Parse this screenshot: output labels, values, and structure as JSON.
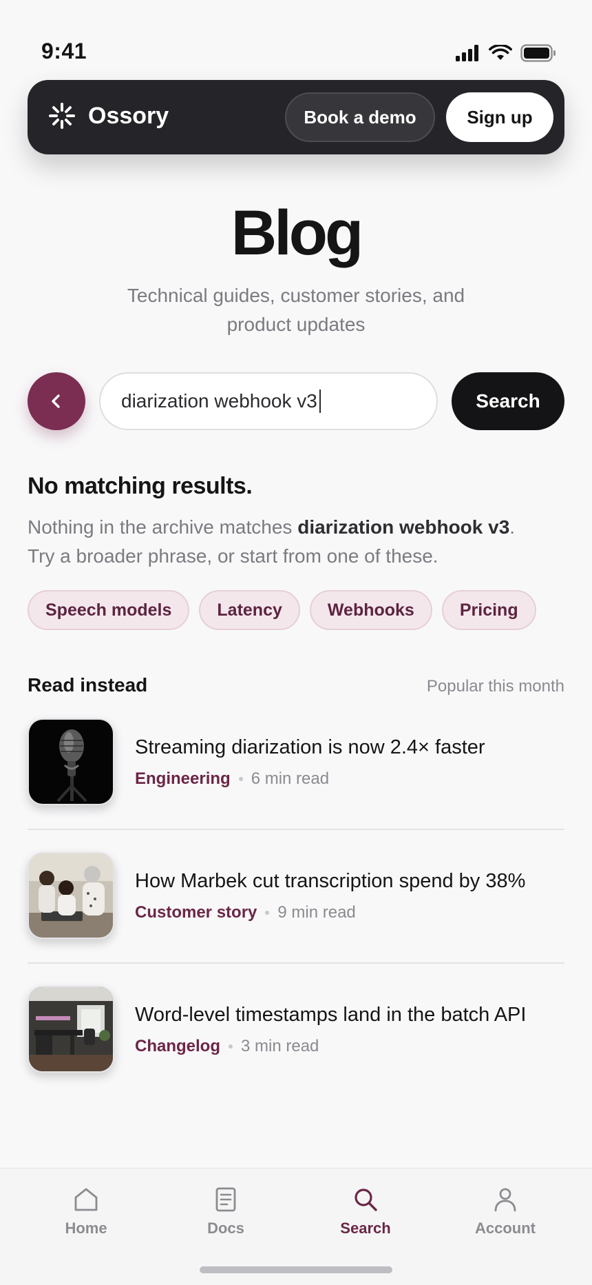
{
  "status_bar": {
    "time": "9:41"
  },
  "nav": {
    "brand": "Ossory",
    "book_demo": "Book a demo",
    "sign_up": "Sign up"
  },
  "header": {
    "title": "Blog",
    "subtitle": "Technical guides, customer stories, and product updates"
  },
  "search": {
    "query": "diarization webhook v3",
    "button": "Search"
  },
  "empty_state": {
    "title": "No matching results.",
    "text_prefix": "Nothing in the archive matches ",
    "query": "diarization webhook v3",
    "text_suffix": ".",
    "text_line2": "Try a broader phrase, or start from one of these."
  },
  "chips": [
    "Speech models",
    "Latency",
    "Webhooks",
    "Pricing"
  ],
  "suggestions": {
    "heading": "Read instead",
    "meta": "Popular this month",
    "articles": [
      {
        "title": "Streaming diarization is now 2.4× faster",
        "category": "Engineering",
        "read_time": "6 min read",
        "thumb": "microphone-photo"
      },
      {
        "title": "How Marbek cut transcription spend by 38%",
        "category": "Customer story",
        "read_time": "9 min read",
        "thumb": "team-photo"
      },
      {
        "title": "Word-level timestamps land in the batch API",
        "category": "Changelog",
        "read_time": "3 min read",
        "thumb": "office-photo"
      }
    ]
  },
  "tabbar": {
    "items": [
      {
        "label": "Home",
        "icon": "home-icon"
      },
      {
        "label": "Docs",
        "icon": "docs-icon"
      },
      {
        "label": "Search",
        "icon": "search-icon",
        "active": true
      },
      {
        "label": "Account",
        "icon": "account-icon"
      }
    ]
  },
  "colors": {
    "accent": "#7b2d52",
    "nav_bg": "#252529",
    "chip_bg": "#f4e7ec"
  }
}
